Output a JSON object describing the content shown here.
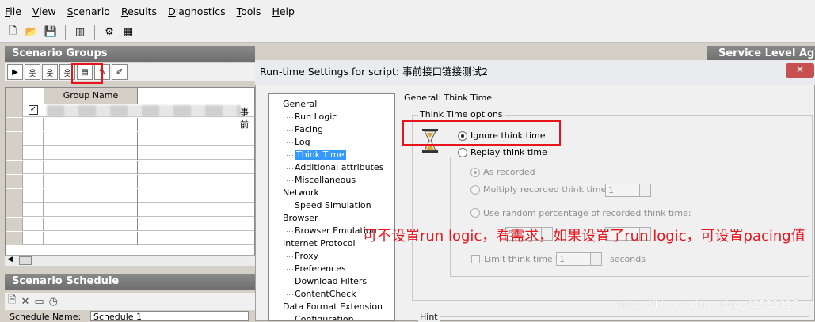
{
  "menu": [
    "File",
    "View",
    "Scenario",
    "Results",
    "Diagnostics",
    "Tools",
    "Help"
  ],
  "groups": {
    "title": "Scenario Groups",
    "column_header": "Group Name",
    "row1_trailing_text": "事前"
  },
  "schedule": {
    "title": "Scenario Schedule",
    "name_label": "Schedule Name:",
    "name_value": "Schedule 1"
  },
  "service_level": {
    "title": "Service Level Agr"
  },
  "dialog": {
    "title": "Run-time Settings for script: 事前接口链接测试2",
    "close_label": "✕",
    "tree": [
      {
        "label": "General",
        "level": 0
      },
      {
        "label": "Run Logic",
        "level": 1
      },
      {
        "label": "Pacing",
        "level": 1
      },
      {
        "label": "Log",
        "level": 1
      },
      {
        "label": "Think Time",
        "level": 1,
        "selected": true
      },
      {
        "label": "Additional attributes",
        "level": 1
      },
      {
        "label": "Miscellaneous",
        "level": 1
      },
      {
        "label": "Network",
        "level": 0
      },
      {
        "label": "Speed Simulation",
        "level": 1
      },
      {
        "label": "Browser",
        "level": 0
      },
      {
        "label": "Browser Emulation",
        "level": 1
      },
      {
        "label": "Internet Protocol",
        "level": 0
      },
      {
        "label": "Proxy",
        "level": 1
      },
      {
        "label": "Preferences",
        "level": 1
      },
      {
        "label": "Download Filters",
        "level": 1
      },
      {
        "label": "ContentCheck",
        "level": 1
      },
      {
        "label": "Data Format Extension",
        "level": 0
      },
      {
        "label": "Configuration",
        "level": 1
      }
    ],
    "section_title": "General: Think Time",
    "think_time_options_label": "Think Time options",
    "ignore_label": "Ignore think time",
    "replay_label": "Replay think time",
    "as_recorded_label": "As recorded",
    "multiply_label": "Multiply recorded think time by:",
    "multiply_value": "1",
    "random_label": "Use random percentage of recorded think time:",
    "min_value": "50",
    "limit_label": "Limit think time to:",
    "limit_value": "1",
    "seconds_label": "seconds",
    "hint_label": "Hint"
  },
  "annotation": "可不设置run logic，看需求，如果设置了run logic，可设置pacing值",
  "watermark": "https://blog.csdn.net/qq_42532915",
  "colors": {
    "annotation_red": "#e8141e",
    "selection_blue": "#3399ff",
    "panel_header": "#7a7a7a"
  }
}
